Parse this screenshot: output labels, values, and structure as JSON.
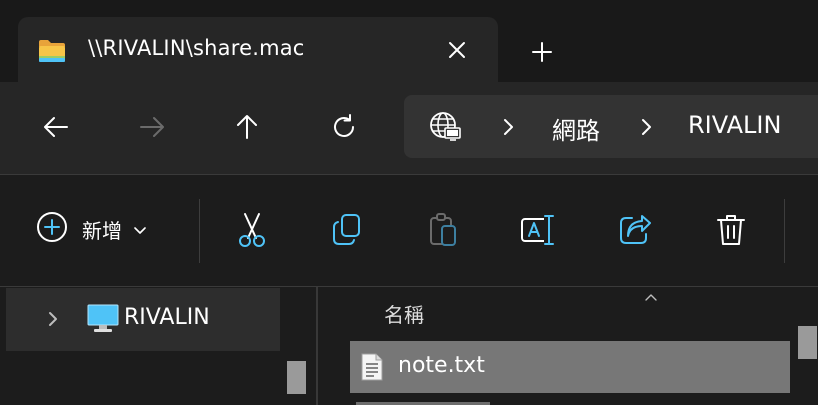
{
  "window": {
    "tab_title": "\\\\RIVALIN\\share.mac",
    "tab_icon": "folder-icon",
    "close_icon": "close-icon",
    "new_tab_icon": "plus-icon"
  },
  "navigation": {
    "back_icon": "arrow-left-icon",
    "forward_icon": "arrow-right-icon",
    "up_icon": "arrow-up-icon",
    "refresh_icon": "refresh-icon"
  },
  "address_bar": {
    "location_icon": "network-globe-icon",
    "breadcrumbs": [
      "網路",
      "RIVALIN"
    ]
  },
  "toolbar": {
    "new_label": "新增",
    "tools": [
      "cut",
      "copy",
      "paste",
      "rename",
      "share",
      "delete"
    ],
    "accent_color": "#4fc3f7"
  },
  "sidebar": {
    "items": [
      {
        "label": "RIVALIN",
        "icon": "computer-icon",
        "expanded": false,
        "selected": true
      }
    ]
  },
  "content": {
    "column_header": "名稱",
    "files": [
      {
        "name": "note.txt",
        "icon": "text-file-icon",
        "selected": true
      }
    ]
  }
}
